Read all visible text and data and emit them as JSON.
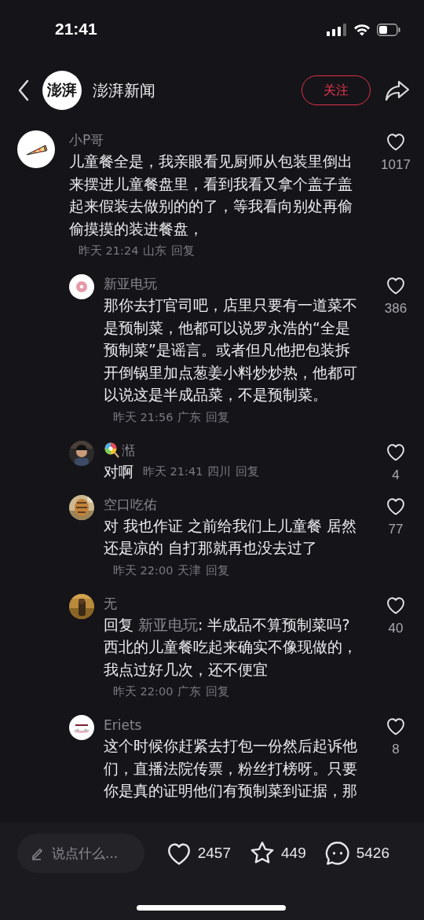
{
  "status_bar": {
    "time": "21:41"
  },
  "header": {
    "logo_text": "澎湃",
    "title": "澎湃新闻",
    "follow_button": "关注"
  },
  "comments": [
    {
      "avatar": {
        "kind": "pizza"
      },
      "name": "小P哥",
      "body": "儿童餐全是，我亲眼看见厨师从包装里倒出来摆进儿童餐盘里，看到我看又拿个盖子盖起来假装去做别的的了，等我看向别处再偷偷摸摸的装进餐盘，",
      "time": "昨天 21:24",
      "location": "山东",
      "reply": "回复",
      "likes": "1017",
      "children": [
        {
          "avatar": {
            "kind": "donut"
          },
          "name": "新亚电玩",
          "body": "那你去打官司吧，店里只要有一道菜不是预制菜，他都可以说罗永浩的“全是预制菜”是谣言。或者但凡他把包装拆开倒锅里加点葱姜小料炒炒热，他都可以说这是半成品菜，不是预制菜。",
          "time": "昨天 21:56",
          "location": "广东",
          "reply": "回复",
          "likes": "386"
        },
        {
          "emoji": true,
          "name": "湉",
          "body": "对啊",
          "time": "昨天 21:41",
          "location": "四川",
          "reply": "回复",
          "likes": "4"
        },
        {
          "name": "空口吃佑",
          "body": "对 我也作证 之前给我们上儿童餐 居然还是凉的  自打那就再也没去过了",
          "time": "昨天 22:00",
          "location": "天津",
          "reply": "回复",
          "likes": "77"
        },
        {
          "name": "无",
          "reply_label": "回复",
          "reply_to": "新亚电玩",
          "body": ": 半成品不算预制菜吗?西北的儿童餐吃起来确实不像现做的，我点过好几次，还不便宜",
          "time": "昨天 22:00",
          "location": "广东",
          "reply": "回复",
          "likes": "40"
        },
        {
          "avatar": {
            "kind": "logo"
          },
          "name": "Eriets",
          "body": "这个时候你赶紧去打包一份然后起诉他们，直播法院传票，粉丝打榜呀。只要你是真的证明他们有预制菜到证据，那",
          "likes": "8"
        }
      ]
    }
  ],
  "bottom_bar": {
    "comment_placeholder": "说点什么...",
    "likes": "2457",
    "favorites": "449",
    "comments": "5426"
  }
}
